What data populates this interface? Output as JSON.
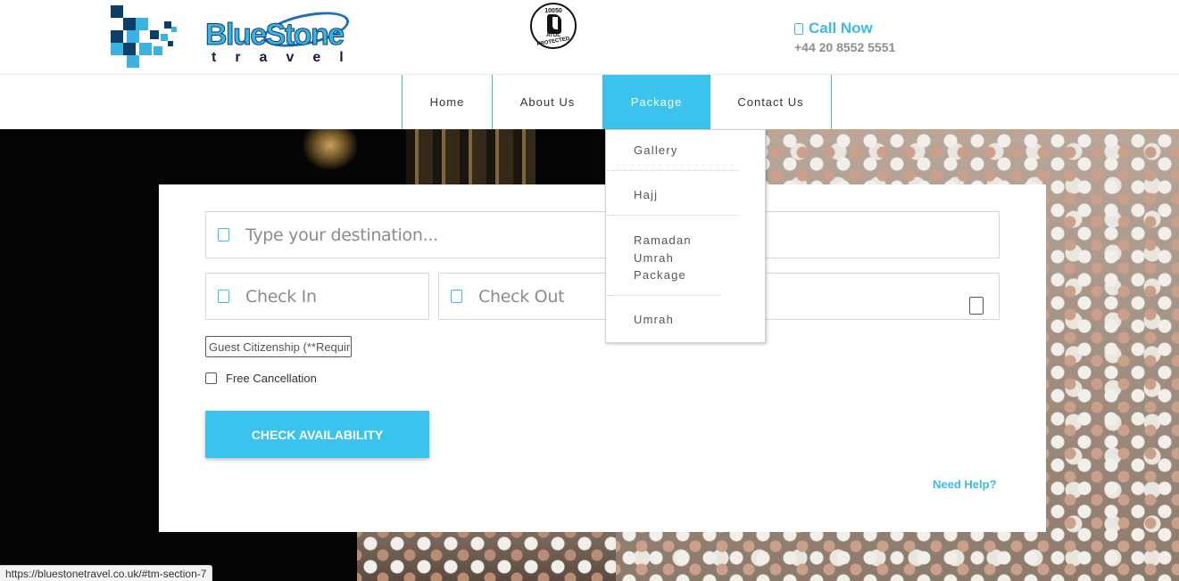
{
  "brand": {
    "logo_text": "BlueStone",
    "logo_subtext": "travel",
    "atol_number": "10050",
    "atol_label": "ATOL",
    "atol_protected": "PROTECTED"
  },
  "contact": {
    "call_label": "Call Now",
    "phone": "+44 20 8552 5551"
  },
  "nav": {
    "items": [
      {
        "label": "Home",
        "active": false
      },
      {
        "label": "About Us",
        "active": false
      },
      {
        "label": "Package",
        "active": true
      },
      {
        "label": "Contact Us",
        "active": false
      }
    ]
  },
  "dropdown": {
    "items": [
      "Gallery",
      "Hajj",
      "Ramadan Umrah Package",
      "Umrah"
    ]
  },
  "search": {
    "destination_placeholder": "Type your destination...",
    "checkin_placeholder": "Check In",
    "checkout_placeholder": "Check Out",
    "citizenship_placeholder": "Guest Citizenship (**Required)",
    "free_cancellation_label": "Free Cancellation",
    "button_label": "CHECK AVAILABILITY",
    "help_link": "Need Help?"
  },
  "status_bar": {
    "url": "https://bluestonetravel.co.uk/#tm-section-7"
  },
  "colors": {
    "accent": "#3bc3ee",
    "logo_dark": "#0b3e6b"
  }
}
